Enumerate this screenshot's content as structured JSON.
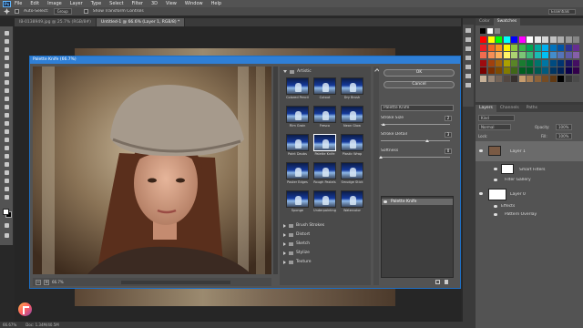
{
  "menubar": {
    "logo": "Ps",
    "items": [
      "File",
      "Edit",
      "Image",
      "Layer",
      "Type",
      "Select",
      "Filter",
      "3D",
      "View",
      "Window",
      "Help"
    ]
  },
  "options": {
    "auto_select": "Auto-Select:",
    "group": "Group",
    "show_transform": "Show Transform Controls",
    "workspace": "Essentials"
  },
  "tabs": [
    {
      "label": "IB-0138949.jpg @ 25.7% (RGB/8#)",
      "active": false
    },
    {
      "label": "Untitled-1 @ 66.6% (Layer 1, RGB/8) *",
      "active": true
    }
  ],
  "dialog": {
    "title": "Palette Knife (66.7%)",
    "zoom": "66.7%",
    "zoom_minus": "−",
    "zoom_plus": "+",
    "gallery": {
      "open_category": "Artistic",
      "thumbs": [
        "Colored Pencil",
        "Cutout",
        "Dry Brush",
        "Film Grain",
        "Fresco",
        "Neon Glow",
        "Paint Daubs",
        "Palette Knife",
        "Plastic Wrap",
        "Poster Edges",
        "Rough Pastels",
        "Smudge Stick",
        "Sponge",
        "Underpainting",
        "Watercolor"
      ],
      "selected": "Palette Knife",
      "categories": [
        "Brush Strokes",
        "Distort",
        "Sketch",
        "Stylize",
        "Texture"
      ]
    },
    "ok": "OK",
    "cancel": "Cancel",
    "filter_select": "Palette Knife",
    "params": [
      {
        "label": "Stroke Size",
        "value": "2",
        "fraction": 0.04
      },
      {
        "label": "Stroke Detail",
        "value": "3",
        "fraction": 0.67
      },
      {
        "label": "Softness",
        "value": "0",
        "fraction": 0.0
      }
    ],
    "effect_layer": "Palette Knife"
  },
  "right": {
    "swatch_tabs": [
      "Color",
      "Swatches"
    ],
    "swatch_colors": [
      "#ff0000",
      "#ffff00",
      "#00ff00",
      "#00ffff",
      "#0000ff",
      "#ff00ff",
      "#ffffff",
      "#ebebeb",
      "#d6d6d6",
      "#c2c2c2",
      "#adadad",
      "#999999",
      "#858585",
      "#ed1c24",
      "#f26522",
      "#f7941d",
      "#fff200",
      "#8dc63f",
      "#39b54a",
      "#00a651",
      "#00a99d",
      "#00aeef",
      "#0072bc",
      "#0054a6",
      "#2e3192",
      "#662d91",
      "#f26c4f",
      "#f68e55",
      "#fbaf5c",
      "#fff467",
      "#acd372",
      "#7cc576",
      "#3bb878",
      "#1abbb4",
      "#00bff3",
      "#438ccb",
      "#5574b9",
      "#605ca8",
      "#855fa8",
      "#9e0b0f",
      "#a0410d",
      "#a36209",
      "#aba000",
      "#598527",
      "#1a7b30",
      "#007236",
      "#00746b",
      "#0076a3",
      "#004b80",
      "#003471",
      "#1b1464",
      "#440e62",
      "#790000",
      "#7b2e00",
      "#7d4900",
      "#827b00",
      "#406618",
      "#005e20",
      "#005826",
      "#005952",
      "#005b7f",
      "#003663",
      "#002157",
      "#0d004c",
      "#32004b",
      "#c7b299",
      "#998675",
      "#736357",
      "#534741",
      "#37302d",
      "#c69c6d",
      "#a67c52",
      "#8c6239",
      "#754c24",
      "#603913",
      "#000000",
      "#363636",
      "#4a4a4a"
    ],
    "layers_tabs": [
      "Layers",
      "Channels",
      "Paths"
    ],
    "kind": "Kind",
    "blend": "Normal",
    "opacity_label": "Opacity:",
    "opacity": "100%",
    "lock_label": "Lock:",
    "fill_label": "Fill:",
    "fill": "100%",
    "layers": [
      {
        "name": "Layer 1"
      },
      {
        "name": "Smart Filters"
      },
      {
        "name": "Filter Gallery"
      },
      {
        "name": "Layer 0"
      },
      {
        "name": "Effects"
      },
      {
        "name": "Pattern Overlay"
      }
    ]
  },
  "status": {
    "zoom": "66.67%",
    "doc": "Doc: 1.34M/40.5M"
  }
}
